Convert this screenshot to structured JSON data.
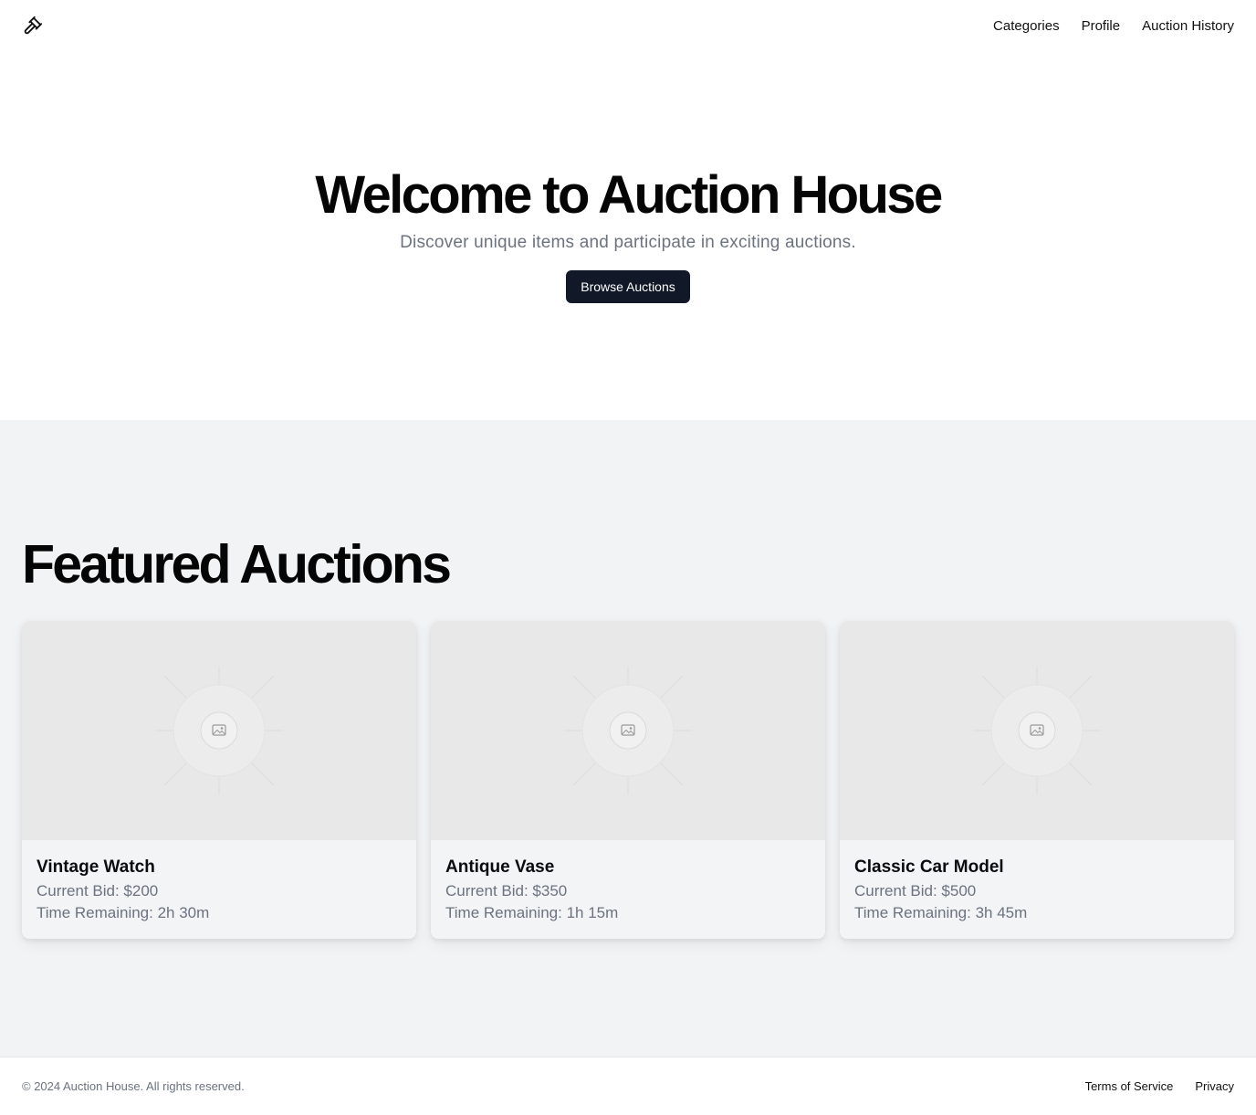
{
  "header": {
    "logo_icon": "gavel-icon",
    "nav": [
      {
        "label": "Categories"
      },
      {
        "label": "Profile"
      },
      {
        "label": "Auction History"
      }
    ]
  },
  "hero": {
    "title": "Welcome to Auction House",
    "subtitle": "Discover unique items and participate in exciting auctions.",
    "cta_label": "Browse Auctions"
  },
  "featured": {
    "title": "Featured Auctions",
    "cards": [
      {
        "title": "Vintage Watch",
        "bid": "Current Bid: $200",
        "time": "Time Remaining: 2h 30m",
        "image_icon": "image-placeholder-icon"
      },
      {
        "title": "Antique Vase",
        "bid": "Current Bid: $350",
        "time": "Time Remaining: 1h 15m",
        "image_icon": "image-placeholder-icon"
      },
      {
        "title": "Classic Car Model",
        "bid": "Current Bid: $500",
        "time": "Time Remaining: 3h 45m",
        "image_icon": "image-placeholder-icon"
      }
    ]
  },
  "footer": {
    "copyright": "© 2024 Auction House. All rights reserved.",
    "links": [
      {
        "label": "Terms of Service"
      },
      {
        "label": "Privacy"
      }
    ]
  },
  "colors": {
    "primary_button": "#111827",
    "muted_text": "#6b7280",
    "section_bg": "#f2f3f5",
    "image_placeholder_bg": "#e8e8e8"
  }
}
